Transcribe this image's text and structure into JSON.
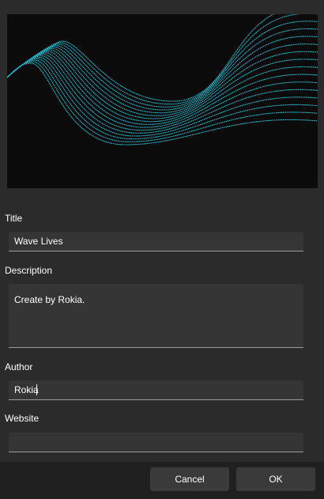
{
  "colors": {
    "background": "#2b2b2b",
    "preview_background": "#0b0b0b",
    "wave_line": "#1ecbe1",
    "input_background": "#353535",
    "footer_background": "#202020",
    "button_background": "#3a3a3a"
  },
  "preview": {
    "icon": "wave-lines-artwork"
  },
  "form": {
    "title": {
      "label": "Title",
      "value": "Wave Lives"
    },
    "description": {
      "label": "Description",
      "value": "Create by Rokia."
    },
    "author": {
      "label": "Author",
      "value": "Rokia"
    },
    "website": {
      "label": "Website",
      "value": ""
    }
  },
  "footer": {
    "cancel_label": "Cancel",
    "ok_label": "OK"
  }
}
